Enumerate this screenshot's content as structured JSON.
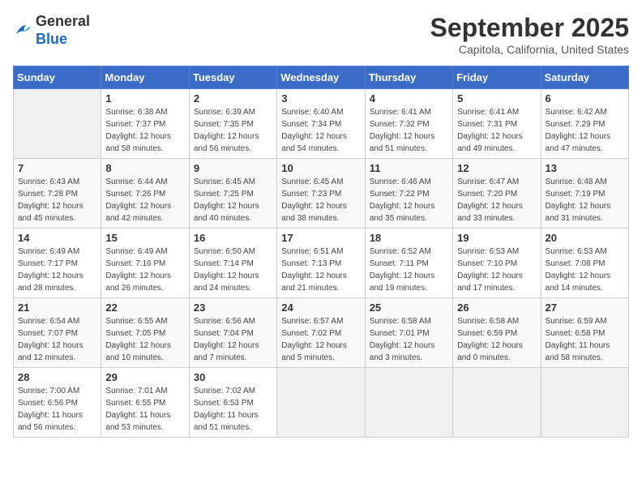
{
  "header": {
    "logo": {
      "general": "General",
      "blue": "Blue"
    },
    "title": "September 2025",
    "location": "Capitola, California, United States"
  },
  "weekdays": [
    "Sunday",
    "Monday",
    "Tuesday",
    "Wednesday",
    "Thursday",
    "Friday",
    "Saturday"
  ],
  "weeks": [
    [
      {
        "day": "",
        "info": ""
      },
      {
        "day": "1",
        "info": "Sunrise: 6:38 AM\nSunset: 7:37 PM\nDaylight: 12 hours\nand 58 minutes."
      },
      {
        "day": "2",
        "info": "Sunrise: 6:39 AM\nSunset: 7:35 PM\nDaylight: 12 hours\nand 56 minutes."
      },
      {
        "day": "3",
        "info": "Sunrise: 6:40 AM\nSunset: 7:34 PM\nDaylight: 12 hours\nand 54 minutes."
      },
      {
        "day": "4",
        "info": "Sunrise: 6:41 AM\nSunset: 7:32 PM\nDaylight: 12 hours\nand 51 minutes."
      },
      {
        "day": "5",
        "info": "Sunrise: 6:41 AM\nSunset: 7:31 PM\nDaylight: 12 hours\nand 49 minutes."
      },
      {
        "day": "6",
        "info": "Sunrise: 6:42 AM\nSunset: 7:29 PM\nDaylight: 12 hours\nand 47 minutes."
      }
    ],
    [
      {
        "day": "7",
        "info": "Sunrise: 6:43 AM\nSunset: 7:28 PM\nDaylight: 12 hours\nand 45 minutes."
      },
      {
        "day": "8",
        "info": "Sunrise: 6:44 AM\nSunset: 7:26 PM\nDaylight: 12 hours\nand 42 minutes."
      },
      {
        "day": "9",
        "info": "Sunrise: 6:45 AM\nSunset: 7:25 PM\nDaylight: 12 hours\nand 40 minutes."
      },
      {
        "day": "10",
        "info": "Sunrise: 6:45 AM\nSunset: 7:23 PM\nDaylight: 12 hours\nand 38 minutes."
      },
      {
        "day": "11",
        "info": "Sunrise: 6:46 AM\nSunset: 7:22 PM\nDaylight: 12 hours\nand 35 minutes."
      },
      {
        "day": "12",
        "info": "Sunrise: 6:47 AM\nSunset: 7:20 PM\nDaylight: 12 hours\nand 33 minutes."
      },
      {
        "day": "13",
        "info": "Sunrise: 6:48 AM\nSunset: 7:19 PM\nDaylight: 12 hours\nand 31 minutes."
      }
    ],
    [
      {
        "day": "14",
        "info": "Sunrise: 6:49 AM\nSunset: 7:17 PM\nDaylight: 12 hours\nand 28 minutes."
      },
      {
        "day": "15",
        "info": "Sunrise: 6:49 AM\nSunset: 7:16 PM\nDaylight: 12 hours\nand 26 minutes."
      },
      {
        "day": "16",
        "info": "Sunrise: 6:50 AM\nSunset: 7:14 PM\nDaylight: 12 hours\nand 24 minutes."
      },
      {
        "day": "17",
        "info": "Sunrise: 6:51 AM\nSunset: 7:13 PM\nDaylight: 12 hours\nand 21 minutes."
      },
      {
        "day": "18",
        "info": "Sunrise: 6:52 AM\nSunset: 7:11 PM\nDaylight: 12 hours\nand 19 minutes."
      },
      {
        "day": "19",
        "info": "Sunrise: 6:53 AM\nSunset: 7:10 PM\nDaylight: 12 hours\nand 17 minutes."
      },
      {
        "day": "20",
        "info": "Sunrise: 6:53 AM\nSunset: 7:08 PM\nDaylight: 12 hours\nand 14 minutes."
      }
    ],
    [
      {
        "day": "21",
        "info": "Sunrise: 6:54 AM\nSunset: 7:07 PM\nDaylight: 12 hours\nand 12 minutes."
      },
      {
        "day": "22",
        "info": "Sunrise: 6:55 AM\nSunset: 7:05 PM\nDaylight: 12 hours\nand 10 minutes."
      },
      {
        "day": "23",
        "info": "Sunrise: 6:56 AM\nSunset: 7:04 PM\nDaylight: 12 hours\nand 7 minutes."
      },
      {
        "day": "24",
        "info": "Sunrise: 6:57 AM\nSunset: 7:02 PM\nDaylight: 12 hours\nand 5 minutes."
      },
      {
        "day": "25",
        "info": "Sunrise: 6:58 AM\nSunset: 7:01 PM\nDaylight: 12 hours\nand 3 minutes."
      },
      {
        "day": "26",
        "info": "Sunrise: 6:58 AM\nSunset: 6:59 PM\nDaylight: 12 hours\nand 0 minutes."
      },
      {
        "day": "27",
        "info": "Sunrise: 6:59 AM\nSunset: 6:58 PM\nDaylight: 11 hours\nand 58 minutes."
      }
    ],
    [
      {
        "day": "28",
        "info": "Sunrise: 7:00 AM\nSunset: 6:56 PM\nDaylight: 11 hours\nand 56 minutes."
      },
      {
        "day": "29",
        "info": "Sunrise: 7:01 AM\nSunset: 6:55 PM\nDaylight: 11 hours\nand 53 minutes."
      },
      {
        "day": "30",
        "info": "Sunrise: 7:02 AM\nSunset: 6:53 PM\nDaylight: 11 hours\nand 51 minutes."
      },
      {
        "day": "",
        "info": ""
      },
      {
        "day": "",
        "info": ""
      },
      {
        "day": "",
        "info": ""
      },
      {
        "day": "",
        "info": ""
      }
    ]
  ]
}
